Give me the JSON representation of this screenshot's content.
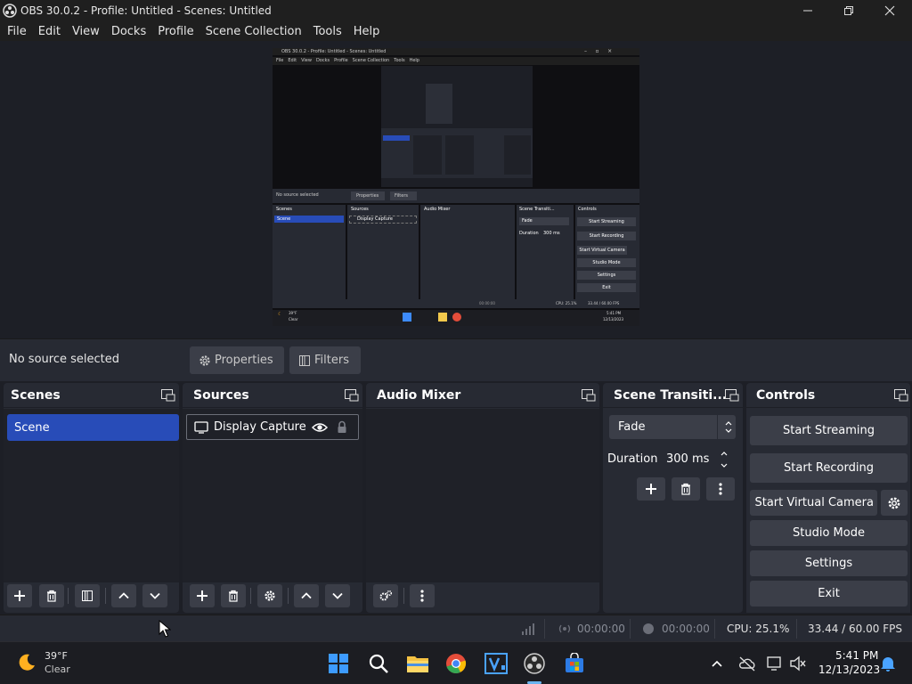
{
  "window": {
    "title": "OBS 30.0.2 - Profile: Untitled - Scenes: Untitled"
  },
  "menu": {
    "items": [
      "File",
      "Edit",
      "View",
      "Docks",
      "Profile",
      "Scene Collection",
      "Tools",
      "Help"
    ]
  },
  "context_bar": {
    "no_source": "No source selected",
    "properties_label": "Properties",
    "filters_label": "Filters"
  },
  "docks": {
    "scenes": {
      "title": "Scenes",
      "items": [
        "Scene"
      ]
    },
    "sources": {
      "title": "Sources",
      "items": [
        {
          "name": "Display Capture",
          "visible": true,
          "locked": false
        }
      ]
    },
    "audio_mixer": {
      "title": "Audio Mixer"
    },
    "scene_transitions": {
      "title": "Scene Transiti...",
      "transition": "Fade",
      "duration_label": "Duration",
      "duration_value": "300 ms"
    },
    "controls": {
      "title": "Controls",
      "start_streaming": "Start Streaming",
      "start_recording": "Start Recording",
      "start_virtual_camera": "Start Virtual Camera",
      "studio_mode": "Studio Mode",
      "settings": "Settings",
      "exit": "Exit"
    }
  },
  "status": {
    "stream_time": "00:00:00",
    "record_time": "00:00:00",
    "cpu": "CPU: 25.1%",
    "fps": "33.44 / 60.00 FPS"
  },
  "taskbar": {
    "weather_temp": "39°F",
    "weather_cond": "Clear",
    "time": "5:41 PM",
    "date": "12/13/2023",
    "apps": [
      "start-icon",
      "search-icon",
      "file-explorer-icon",
      "chrome-icon",
      "visual-studio-icon",
      "obs-icon",
      "microsoft-store-icon"
    ]
  },
  "colors": {
    "accent": "#284cb8",
    "dock_bg": "#272a33",
    "app_bg": "#1d1f26",
    "button": "#3b3e48"
  },
  "preview": {
    "title": "OBS 30.0.2 - Profile: Untitled - Scenes: Untitled",
    "menu": [
      "File",
      "Edit",
      "View",
      "Docks",
      "Profile",
      "Scene Collection",
      "Tools",
      "Help"
    ],
    "no_source": "No source selected",
    "properties_label": "Properties",
    "filters_label": "Filters",
    "scenes_title": "Scenes",
    "scene_item": "Scene",
    "sources_title": "Sources",
    "source_item": "Display Capture",
    "audio_title": "Audio Mixer",
    "transitions_title": "Scene Transiti...",
    "transition": "Fade",
    "duration_label": "Duration",
    "duration_value": "300 ms",
    "controls_title": "Controls",
    "controls": [
      "Start Streaming",
      "Start Recording",
      "Start Virtual Camera",
      "Studio Mode",
      "Settings",
      "Exit"
    ],
    "status_time": "00:00:00",
    "cpu": "CPU: 25.1%",
    "fps": "33.44 / 60.00 FPS",
    "weather_temp": "39°F",
    "weather_cond": "Clear",
    "time": "5:41 PM",
    "date": "12/13/2023"
  }
}
